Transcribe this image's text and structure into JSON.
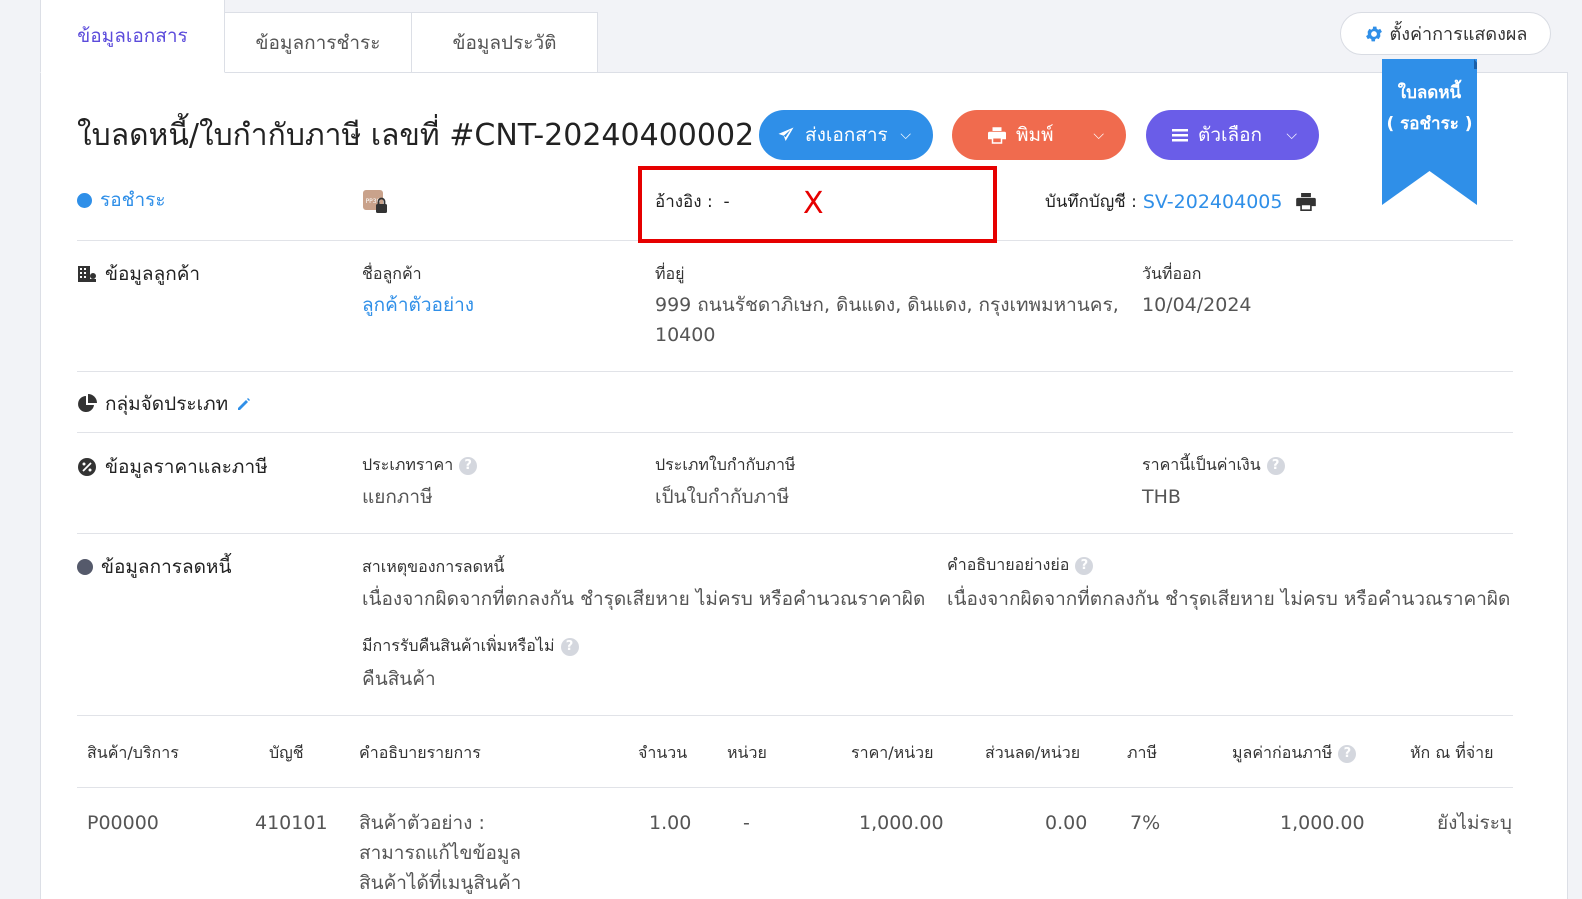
{
  "tabs": [
    "ข้อมูลเอกสาร",
    "ข้อมูลการชำระ",
    "ข้อมูลประวัติ"
  ],
  "settings_label": "ตั้งค่าการแสดงผล",
  "ribbon": {
    "line1": "ใบลดหนี้",
    "line2": "( รอชำระ )",
    "color": "#2f8fe8"
  },
  "title": "ใบลดหนี้/ใบกำกับภาษี เลขที่ #CNT-20240400002",
  "actions": {
    "send": "ส่งเอกสาร",
    "print": "พิมพ์",
    "options": "ตัวเลือก"
  },
  "status": "รอชำระ",
  "pp30_icon_text": "PP30",
  "reference": {
    "label": "อ้างอิง :",
    "value": "-",
    "mark": "X"
  },
  "account_record": {
    "label": "บันทึกบัญชี :",
    "value": "SV-202404005"
  },
  "customer": {
    "section": "ข้อมูลลูกค้า",
    "name_label": "ชื่อลูกค้า",
    "name": "ลูกค้าตัวอย่าง",
    "address_label": "ที่อยู่",
    "address_line1": "999 ถนนรัชดาภิเษก, ดินแดง, ดินแดง, กรุงเทพมหานคร,",
    "address_line2": "10400",
    "issue_date_label": "วันที่ออก",
    "issue_date": "10/04/2024"
  },
  "category": {
    "section": "กลุ่มจัดประเภท"
  },
  "pricing": {
    "section": "ข้อมูลราคาและภาษี",
    "price_type_label": "ประเภทราคา",
    "price_type": "แยกภาษี",
    "tax_invoice_type_label": "ประเภทใบกำกับภาษี",
    "tax_invoice_type": "เป็นใบกำกับภาษี",
    "currency_label": "ราคานี้เป็นค่าเงิน",
    "currency": "THB"
  },
  "credit_note": {
    "section": "ข้อมูลการลดหนี้",
    "reason_label": "สาเหตุของการลดหนี้",
    "reason": "เนื่องจากผิดจากที่ตกลงกัน ชำรุดเสียหาย ไม่ครบ หรือคำนวณราคาผิด",
    "summary_label": "คำอธิบายอย่างย่อ",
    "summary": "เนื่องจากผิดจากที่ตกลงกัน ชำรุดเสียหาย ไม่ครบ หรือคำนวณราคาผิด",
    "return_label": "มีการรับคืนสินค้าเพิ่มหรือไม่",
    "return_value": "คืนสินค้า"
  },
  "table": {
    "headers": {
      "product": "สินค้า/บริการ",
      "account": "บัญชี",
      "description": "คำอธิบายรายการ",
      "qty": "จำนวน",
      "unit": "หน่วย",
      "price": "ราคา/หน่วย",
      "discount": "ส่วนลด/หน่วย",
      "tax": "ภาษี",
      "pretax": "มูลค่าก่อนภาษี",
      "withholding": "หัก ณ ที่จ่าย"
    },
    "row": {
      "product": "P00000",
      "account": "410101",
      "desc_line1": "สินค้าตัวอย่าง :",
      "desc_line2": "สามารถแก้ไขข้อมูล",
      "desc_line3": "สินค้าได้ที่เมนูสินค้า",
      "qty": "1.00",
      "unit": "-",
      "price": "1,000.00",
      "discount": "0.00",
      "tax": "7%",
      "pretax": "1,000.00",
      "withholding": "ยังไม่ระบุ"
    }
  }
}
